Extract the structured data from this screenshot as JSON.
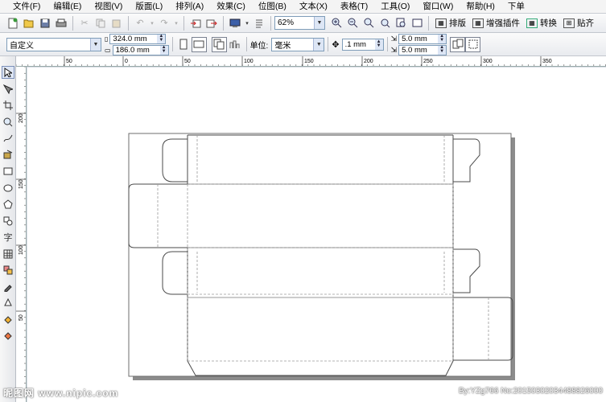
{
  "menu": [
    "文件(F)",
    "编辑(E)",
    "视图(V)",
    "版面(L)",
    "排列(A)",
    "效果(C)",
    "位图(B)",
    "文本(X)",
    "表格(T)",
    "工具(O)",
    "窗口(W)",
    "帮助(H)",
    "下单"
  ],
  "toolbar1": {
    "zoom": "62%",
    "layout_label": "排版",
    "plugin_label": "增强插件",
    "convert_label": "转换",
    "align_label": "贴齐"
  },
  "toolbar2": {
    "page_preset": "自定义",
    "page_width": "324.0 mm",
    "page_height": "186.0 mm",
    "units_label": "单位:",
    "units_value": "毫米",
    "nudge": ".1 mm",
    "dup_x": "5.0 mm",
    "dup_y": "5.0 mm"
  },
  "ruler_h_labels": [
    "50",
    "0",
    "50",
    "100",
    "150",
    "200",
    "250",
    "300",
    "350"
  ],
  "ruler_v_labels": [
    "200",
    "150",
    "100",
    "50"
  ],
  "tool_glyph_zi": "字",
  "watermark_left": "昵图网 www.nipic.com",
  "watermark_right": "By:YZg766 No:20150302034488826000",
  "colors": {
    "page_border": "#555555",
    "shadow": "#888888",
    "fold_line": "#8a8a8a"
  }
}
